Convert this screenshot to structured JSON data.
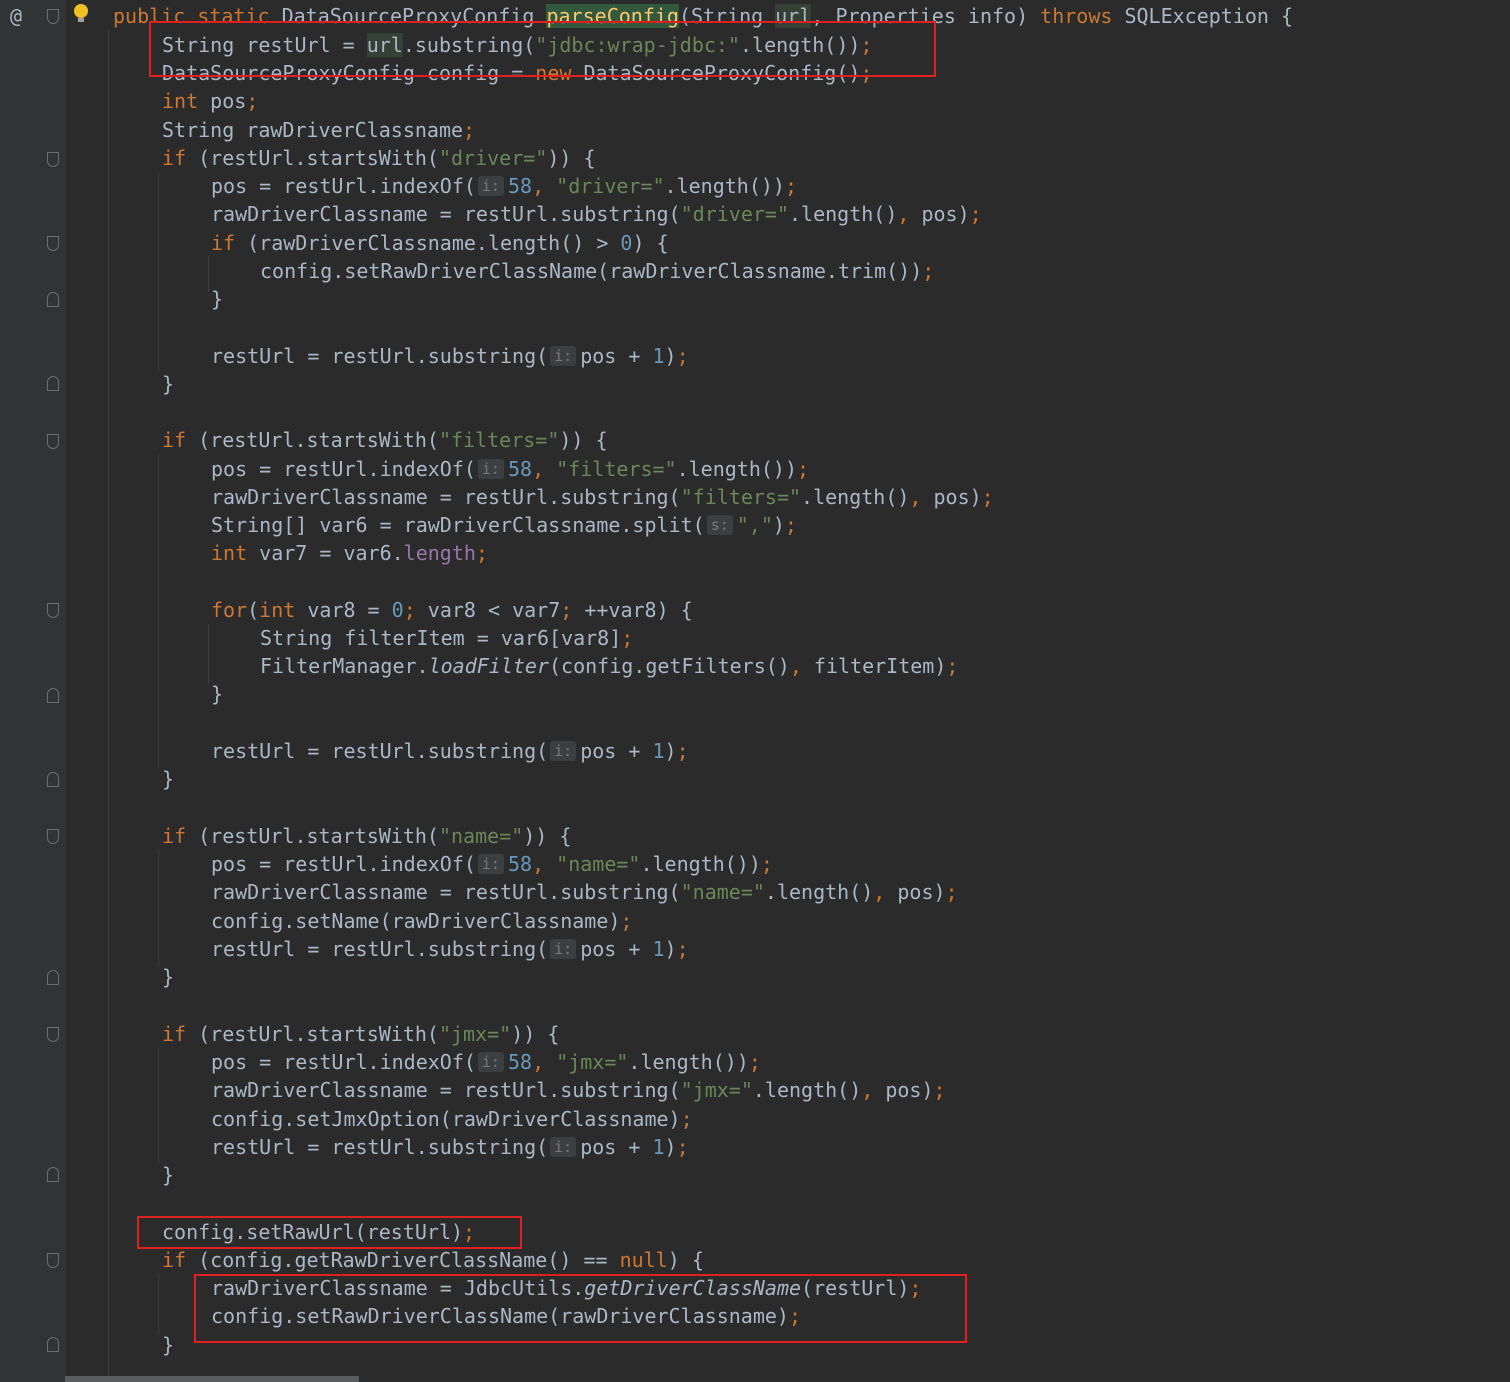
{
  "editor": {
    "gutter_markers": {
      "override_marker": "@",
      "intention_icon": "lightbulb-icon"
    },
    "colors": {
      "background": "#2b2b2b",
      "keyword": "#cc7832",
      "string": "#6a8759",
      "number": "#6897bb",
      "field": "#9876aa",
      "text": "#a9b7c6",
      "annotation_box": "#e02020"
    },
    "code": {
      "l0": {
        "a": "public static ",
        "b": "DataSourceProxyConfig ",
        "c": "parseConfig",
        "d": "(String ",
        "e": "url",
        "f": ", Properties info) ",
        "g": "throws ",
        "h": "SQLException {"
      },
      "l1": {
        "a": "String restUrl = ",
        "b": "url",
        "c": ".substring(",
        "d": "\"jdbc:wrap-jdbc:\"",
        "e": ".length())",
        "f": ";"
      },
      "l2": {
        "a": "DataSourceProxyConfig config = ",
        "b": "new ",
        "c": "DataSourceProxyConfig()",
        "d": ";"
      },
      "l3": {
        "a": "int ",
        "b": "pos",
        "c": ";"
      },
      "l4": {
        "a": "String rawDriverClassname",
        "b": ";"
      },
      "l5": {
        "a": "if ",
        "b": "(restUrl.startsWith(",
        "c": "\"driver=\"",
        "d": ")) {"
      },
      "l6": {
        "a": "pos = restUrl.indexOf(",
        "hint": "i:",
        "b": "58",
        "c": ", ",
        "d": "\"driver=\"",
        "e": ".length())",
        "f": ";"
      },
      "l7": {
        "a": "rawDriverClassname = restUrl.substring(",
        "b": "\"driver=\"",
        "c": ".length()",
        "d": ", ",
        "e": "pos)",
        "f": ";"
      },
      "l8": {
        "a": "if ",
        "b": "(rawDriverClassname.length() > ",
        "c": "0",
        "d": ") {"
      },
      "l9": {
        "a": "config.setRawDriverClassName(rawDriverClassname.trim())",
        "b": ";"
      },
      "l10": {
        "a": "}"
      },
      "l11": {
        "a": "restUrl = restUrl.substring(",
        "hint": "i:",
        "b": "pos + ",
        "c": "1",
        "d": ")",
        "e": ";"
      },
      "l12": {
        "a": "}"
      },
      "l13": {
        "a": "if ",
        "b": "(restUrl.startsWith(",
        "c": "\"filters=\"",
        "d": ")) {"
      },
      "l14": {
        "a": "pos = restUrl.indexOf(",
        "hint": "i:",
        "b": "58",
        "c": ", ",
        "d": "\"filters=\"",
        "e": ".length())",
        "f": ";"
      },
      "l15": {
        "a": "rawDriverClassname = restUrl.substring(",
        "b": "\"filters=\"",
        "c": ".length()",
        "d": ", ",
        "e": "pos)",
        "f": ";"
      },
      "l16": {
        "a": "String[] var6 = rawDriverClassname.split(",
        "hint": "s:",
        "b": "\",\"",
        "c": ")",
        "d": ";"
      },
      "l17": {
        "a": "int ",
        "b": "var7 = var6.",
        "c": "length",
        "d": ";"
      },
      "l18": {
        "a": "for",
        "b": "(",
        "c": "int ",
        "d": "var8 = ",
        "e": "0",
        "f": "; ",
        "g": "var8 < var7",
        "h": "; ",
        "i": "++var8) {"
      },
      "l19": {
        "a": "String filterItem = var6[var8]",
        "b": ";"
      },
      "l20": {
        "a": "FilterManager.",
        "b": "loadFilter",
        "c": "(config.getFilters()",
        "d": ", ",
        "e": "filterItem)",
        "f": ";"
      },
      "l21": {
        "a": "}"
      },
      "l22": {
        "a": "restUrl = restUrl.substring(",
        "hint": "i:",
        "b": "pos + ",
        "c": "1",
        "d": ")",
        "e": ";"
      },
      "l23": {
        "a": "}"
      },
      "l24": {
        "a": "if ",
        "b": "(restUrl.startsWith(",
        "c": "\"name=\"",
        "d": ")) {"
      },
      "l25": {
        "a": "pos = restUrl.indexOf(",
        "hint": "i:",
        "b": "58",
        "c": ", ",
        "d": "\"name=\"",
        "e": ".length())",
        "f": ";"
      },
      "l26": {
        "a": "rawDriverClassname = restUrl.substring(",
        "b": "\"name=\"",
        "c": ".length()",
        "d": ", ",
        "e": "pos)",
        "f": ";"
      },
      "l27": {
        "a": "config.setName(rawDriverClassname)",
        "b": ";"
      },
      "l28": {
        "a": "restUrl = restUrl.substring(",
        "hint": "i:",
        "b": "pos + ",
        "c": "1",
        "d": ")",
        "e": ";"
      },
      "l29": {
        "a": "}"
      },
      "l30": {
        "a": "if ",
        "b": "(restUrl.startsWith(",
        "c": "\"jmx=\"",
        "d": ")) {"
      },
      "l31": {
        "a": "pos = restUrl.indexOf(",
        "hint": "i:",
        "b": "58",
        "c": ", ",
        "d": "\"jmx=\"",
        "e": ".length())",
        "f": ";"
      },
      "l32": {
        "a": "rawDriverClassname = restUrl.substring(",
        "b": "\"jmx=\"",
        "c": ".length()",
        "d": ", ",
        "e": "pos)",
        "f": ";"
      },
      "l33": {
        "a": "config.setJmxOption(rawDriverClassname)",
        "b": ";"
      },
      "l34": {
        "a": "restUrl = restUrl.substring(",
        "hint": "i:",
        "b": "pos + ",
        "c": "1",
        "d": ")",
        "e": ";"
      },
      "l35": {
        "a": "}"
      },
      "l36": {
        "a": "config.setRawUrl(restUrl)",
        "b": ";"
      },
      "l37": {
        "a": "if ",
        "b": "(config.getRawDriverClassName() == ",
        "c": "null",
        "d": ") {"
      },
      "l38": {
        "a": "rawDriverClassname = JdbcUtils.",
        "b": "getDriverClassName",
        "c": "(restUrl)",
        "d": ";"
      },
      "l39": {
        "a": "config.setRawDriverClassName(rawDriverClassname)",
        "b": ";"
      },
      "l40": {
        "a": "}"
      }
    }
  }
}
